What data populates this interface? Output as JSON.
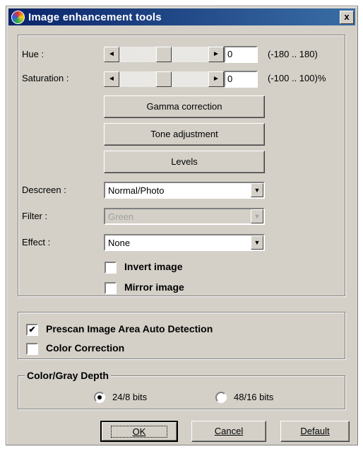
{
  "window": {
    "title": "Image enhancement tools",
    "close_glyph": "x"
  },
  "hue": {
    "label": "Hue :",
    "value": "0",
    "range": "(-180 .. 180)"
  },
  "saturation": {
    "label": "Saturation :",
    "value": "0",
    "range": "(-100 .. 100)%"
  },
  "buttons": {
    "gamma": "Gamma correction",
    "tone": "Tone adjustment",
    "levels": "Levels"
  },
  "descreen": {
    "label": "Descreen :",
    "value": "Normal/Photo"
  },
  "filter": {
    "label": "Filter :",
    "value": "Green"
  },
  "effect": {
    "label": "Effect :",
    "value": "None"
  },
  "checks": {
    "invert": {
      "label": "Invert image",
      "checked": false
    },
    "mirror": {
      "label": "Mirror image",
      "checked": false
    },
    "prescan": {
      "label": "Prescan Image Area Auto Detection",
      "checked": true
    },
    "color_correction": {
      "label": "Color Correction",
      "checked": false
    }
  },
  "depth": {
    "legend": "Color/Gray Depth",
    "option1": "24/8 bits",
    "option2": "48/16 bits",
    "selected": "24/8 bits"
  },
  "footer": {
    "ok": "OK",
    "cancel": "Cancel",
    "default": "Default"
  },
  "icons": {
    "arrow_left": "◄",
    "arrow_right": "►",
    "dropdown": "▼",
    "check": "✔"
  }
}
